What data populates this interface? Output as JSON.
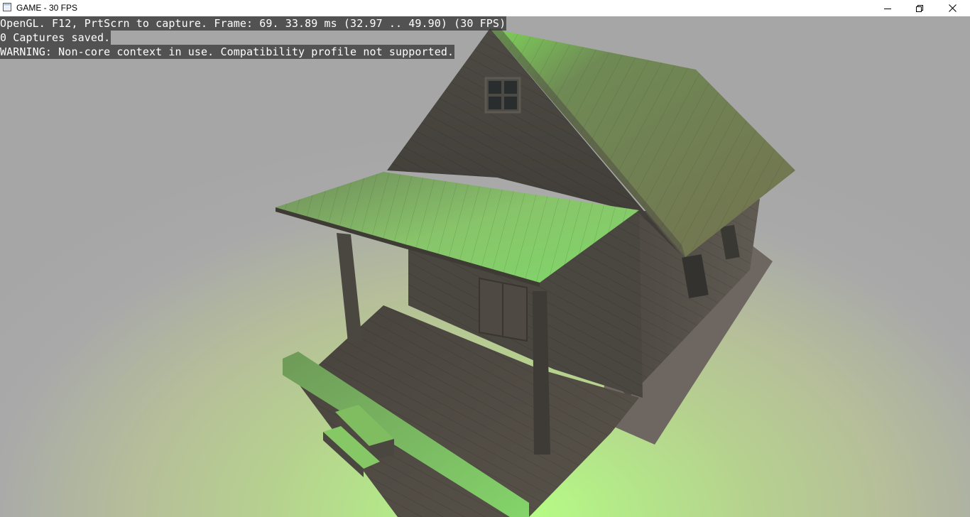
{
  "window": {
    "title": "GAME - 30 FPS",
    "controls": [
      "minimize-icon",
      "maximize-icon",
      "close-icon"
    ]
  },
  "overlay": {
    "lines": [
      "OpenGL. F12, PrtScrn to capture. Frame: 69. 33.89 ms (32.97 .. 49.90) (30 FPS)",
      "0 Captures saved.",
      "WARNING: Non-core context in use. Compatibility profile not supported."
    ]
  },
  "scene": {
    "subject": "wooden-cabin-with-porch",
    "colors": {
      "background": "#a6a6a6",
      "ground_glow": "#b6ff84",
      "wood_dark": "#4f4a44",
      "roof_green": "#7fbf60",
      "shadow": "#6e6660"
    }
  }
}
